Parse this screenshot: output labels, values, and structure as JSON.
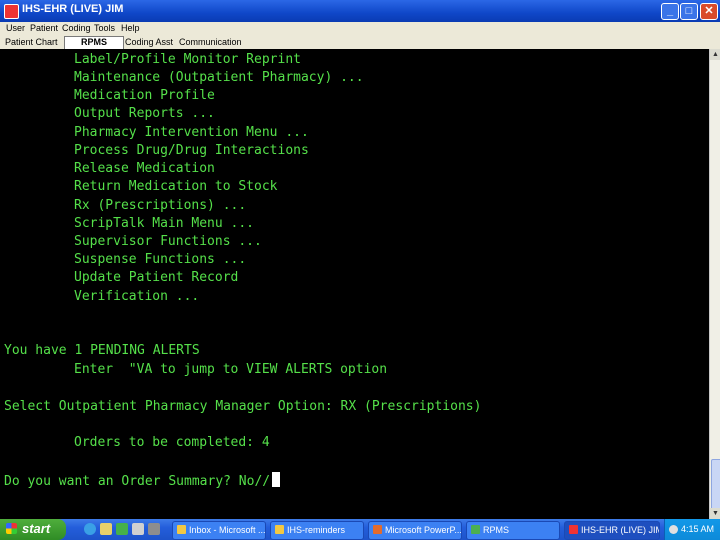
{
  "window": {
    "title": "IHS-EHR (LIVE) JIM",
    "min_glyph": "_",
    "max_glyph": "□",
    "close_glyph": "✕"
  },
  "menu": [
    "User",
    "Patient",
    "Coding",
    "Tools",
    "Help"
  ],
  "tabs": [
    "Patient Chart",
    "RPMS",
    "Coding Asst",
    "Communication"
  ],
  "active_tab": "RPMS",
  "terminal": {
    "menu_items": [
      "Label/Profile Monitor Reprint",
      "Maintenance (Outpatient Pharmacy) ...",
      "Medication Profile",
      "Output Reports ...",
      "Pharmacy Intervention Menu ...",
      "Process Drug/Drug Interactions",
      "Release Medication",
      "Return Medication to Stock",
      "Rx (Prescriptions) ...",
      "ScripTalk Main Menu ...",
      "Supervisor Functions ...",
      "Suspense Functions ...",
      "Update Patient Record",
      "Verification ..."
    ],
    "alert_line": "You have 1 PENDING ALERTS",
    "alert_hint": "Enter  \"VA to jump to VIEW ALERTS option",
    "select_prompt": "Select Outpatient Pharmacy Manager Option: RX (Prescriptions)",
    "orders_line": "Orders to be completed: 4",
    "summary_prompt": "Do you want an Order Summary? No//"
  },
  "taskbar": {
    "start_label": "start",
    "tasks": [
      {
        "label": "Inbox - Microsoft ...",
        "active": false
      },
      {
        "label": "IHS-reminders",
        "active": false
      },
      {
        "label": "Microsoft PowerP...",
        "active": false
      },
      {
        "label": "RPMS",
        "active": false
      },
      {
        "label": "IHS-EHR (LIVE) JIM",
        "active": true
      }
    ],
    "clock": "4:15 AM"
  },
  "colors": {
    "terminal_text": "#55e04a",
    "terminal_bg": "#000000",
    "titlebar": "#0f47c8",
    "taskbar": "#245edb",
    "start_button": "#2f8c25"
  }
}
